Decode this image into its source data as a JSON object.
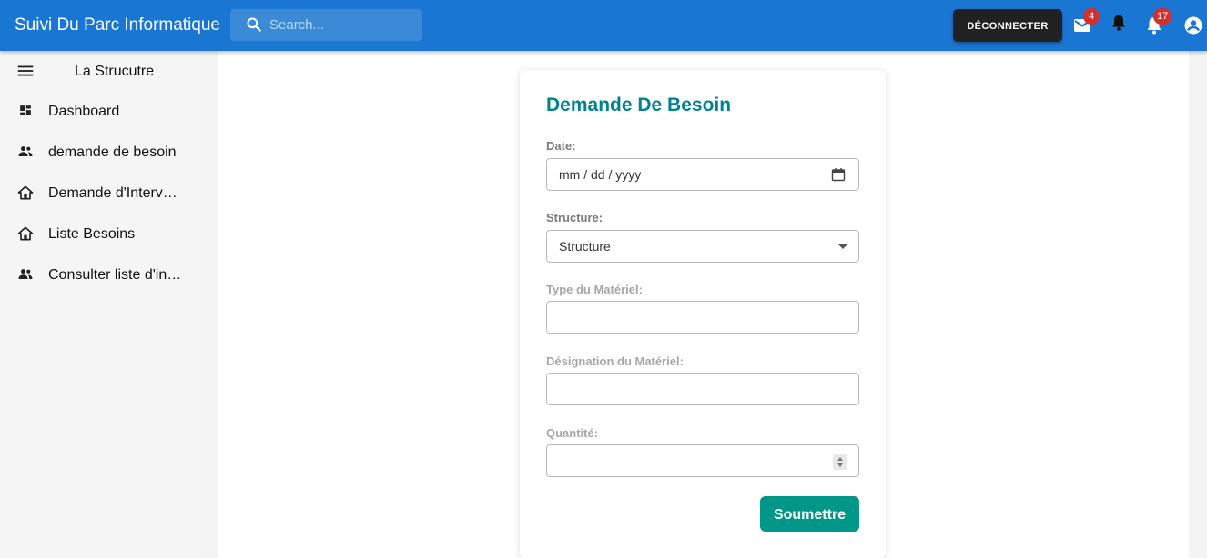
{
  "app": {
    "title": "Suivi Du Parc Informatique"
  },
  "search": {
    "placeholder": "Search..."
  },
  "header": {
    "logout_label": "DÉCONNECTER",
    "mail_badge": "4",
    "notifications_badge": "17"
  },
  "sidebar": {
    "title": "La Strucutre",
    "items": [
      {
        "label": "Dashboard",
        "icon": "dashboard-icon"
      },
      {
        "label": "demande de besoin",
        "icon": "people-icon"
      },
      {
        "label": "Demande d'Intervention",
        "icon": "home-icon"
      },
      {
        "label": "Liste Besoins",
        "icon": "home-icon"
      },
      {
        "label": "Consulter liste d'interventions",
        "icon": "people-icon"
      }
    ]
  },
  "form": {
    "title": "Demande De Besoin",
    "date_label": "Date:",
    "date_placeholder": "mm / dd / yyyy",
    "structure_label": "Structure:",
    "structure_value": "Structure",
    "type_label": "Type du Matériel:",
    "type_value": "",
    "designation_label": "Désignation du Matériel:",
    "designation_value": "",
    "quantity_label": "Quantité:",
    "quantity_value": "",
    "submit_label": "Soumettre"
  },
  "colors": {
    "appbar": "#1976d2",
    "title_accent": "#00838f",
    "submit": "#009688",
    "badge": "#d32f2f"
  }
}
